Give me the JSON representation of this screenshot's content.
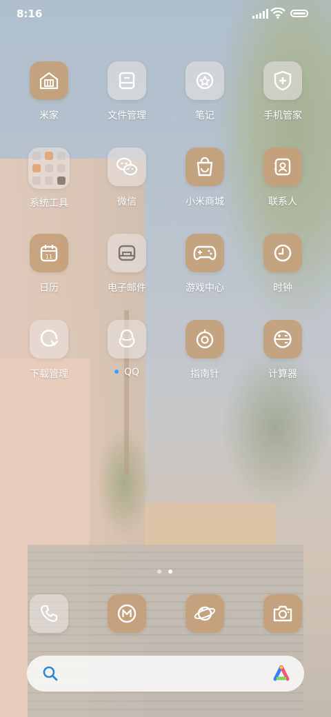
{
  "status_bar": {
    "time": "8:16"
  },
  "apps": [
    {
      "name": "mijia",
      "label": "米家",
      "icon": "house-icon",
      "style": "tan"
    },
    {
      "name": "file-manager",
      "label": "文件管理",
      "icon": "folder-doc-icon",
      "style": "glass"
    },
    {
      "name": "notes",
      "label": "笔记",
      "icon": "star-badge-icon",
      "style": "glass"
    },
    {
      "name": "security",
      "label": "手机管家",
      "icon": "shield-plus-icon",
      "style": "glass"
    },
    {
      "name": "system-tools",
      "label": "系统工具",
      "icon": "folder-grid-icon",
      "style": "glass"
    },
    {
      "name": "wechat",
      "label": "微信",
      "icon": "chat-bubbles-icon",
      "style": "glass"
    },
    {
      "name": "mi-store",
      "label": "小米商城",
      "icon": "shopping-bag-icon",
      "style": "tan"
    },
    {
      "name": "contacts",
      "label": "联系人",
      "icon": "contact-card-icon",
      "style": "tan"
    },
    {
      "name": "calendar",
      "label": "日历",
      "icon": "calendar-icon",
      "style": "tan",
      "day": "11"
    },
    {
      "name": "email",
      "label": "电子邮件",
      "icon": "inbox-icon",
      "style": "glass"
    },
    {
      "name": "game-center",
      "label": "游戏中心",
      "icon": "gamepad-icon",
      "style": "tan"
    },
    {
      "name": "clock",
      "label": "时钟",
      "icon": "clock-icon",
      "style": "tan"
    },
    {
      "name": "downloads",
      "label": "下载管理",
      "icon": "download-arrow-icon",
      "style": "glass"
    },
    {
      "name": "qq",
      "label": "QQ",
      "icon": "penguin-icon",
      "style": "glass",
      "new": true
    },
    {
      "name": "compass",
      "label": "指南针",
      "icon": "compass-icon",
      "style": "tan"
    },
    {
      "name": "calculator",
      "label": "计算器",
      "icon": "calculator-icon",
      "style": "tan"
    }
  ],
  "pager": {
    "pages": 2,
    "current": 2
  },
  "dock": [
    {
      "name": "phone",
      "icon": "phone-icon",
      "style": "glass"
    },
    {
      "name": "messages",
      "icon": "m-circle-icon",
      "style": "tan"
    },
    {
      "name": "browser",
      "icon": "planet-icon",
      "style": "tan"
    },
    {
      "name": "camera",
      "icon": "camera-icon",
      "style": "tan"
    }
  ],
  "search": {
    "placeholder": ""
  }
}
